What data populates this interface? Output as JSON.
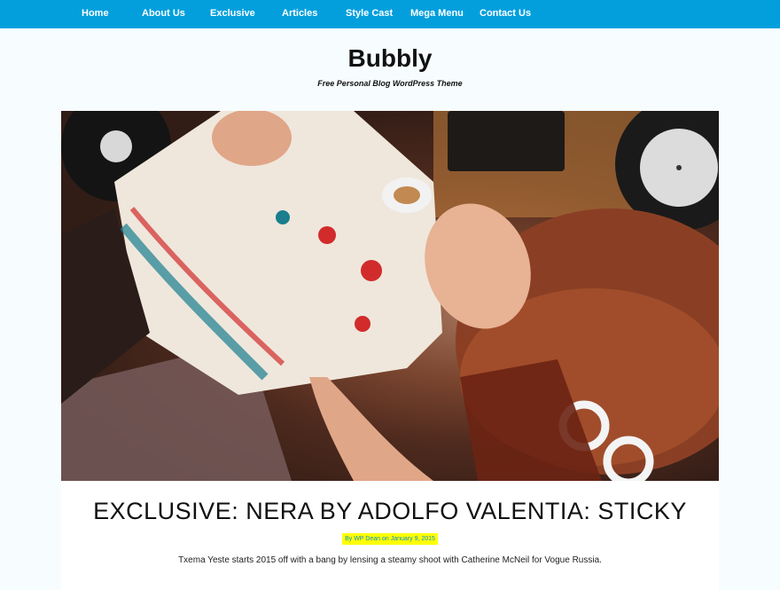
{
  "nav": {
    "items": [
      "Home",
      "About Us",
      "Exclusive",
      "Articles",
      "Style Cast",
      "Mega Menu",
      "Contact Us"
    ]
  },
  "site": {
    "title": "Bubbly",
    "tagline": "Free Personal Blog WordPress Theme"
  },
  "post": {
    "title": "EXCLUSIVE: NERA BY ADOLFO VALENTIA: STICKY",
    "meta_by": "By",
    "author": "WP Dean",
    "meta_on": "on",
    "date": "January 9, 2015",
    "excerpt": "Txema Yeste starts 2015 off with a bang by lensing a steamy shoot with Catherine McNeil for Vogue Russia."
  },
  "colors": {
    "nav_bg": "#039fdd",
    "meta_highlight": "#ffff00",
    "meta_link": "#0b8fd0"
  }
}
